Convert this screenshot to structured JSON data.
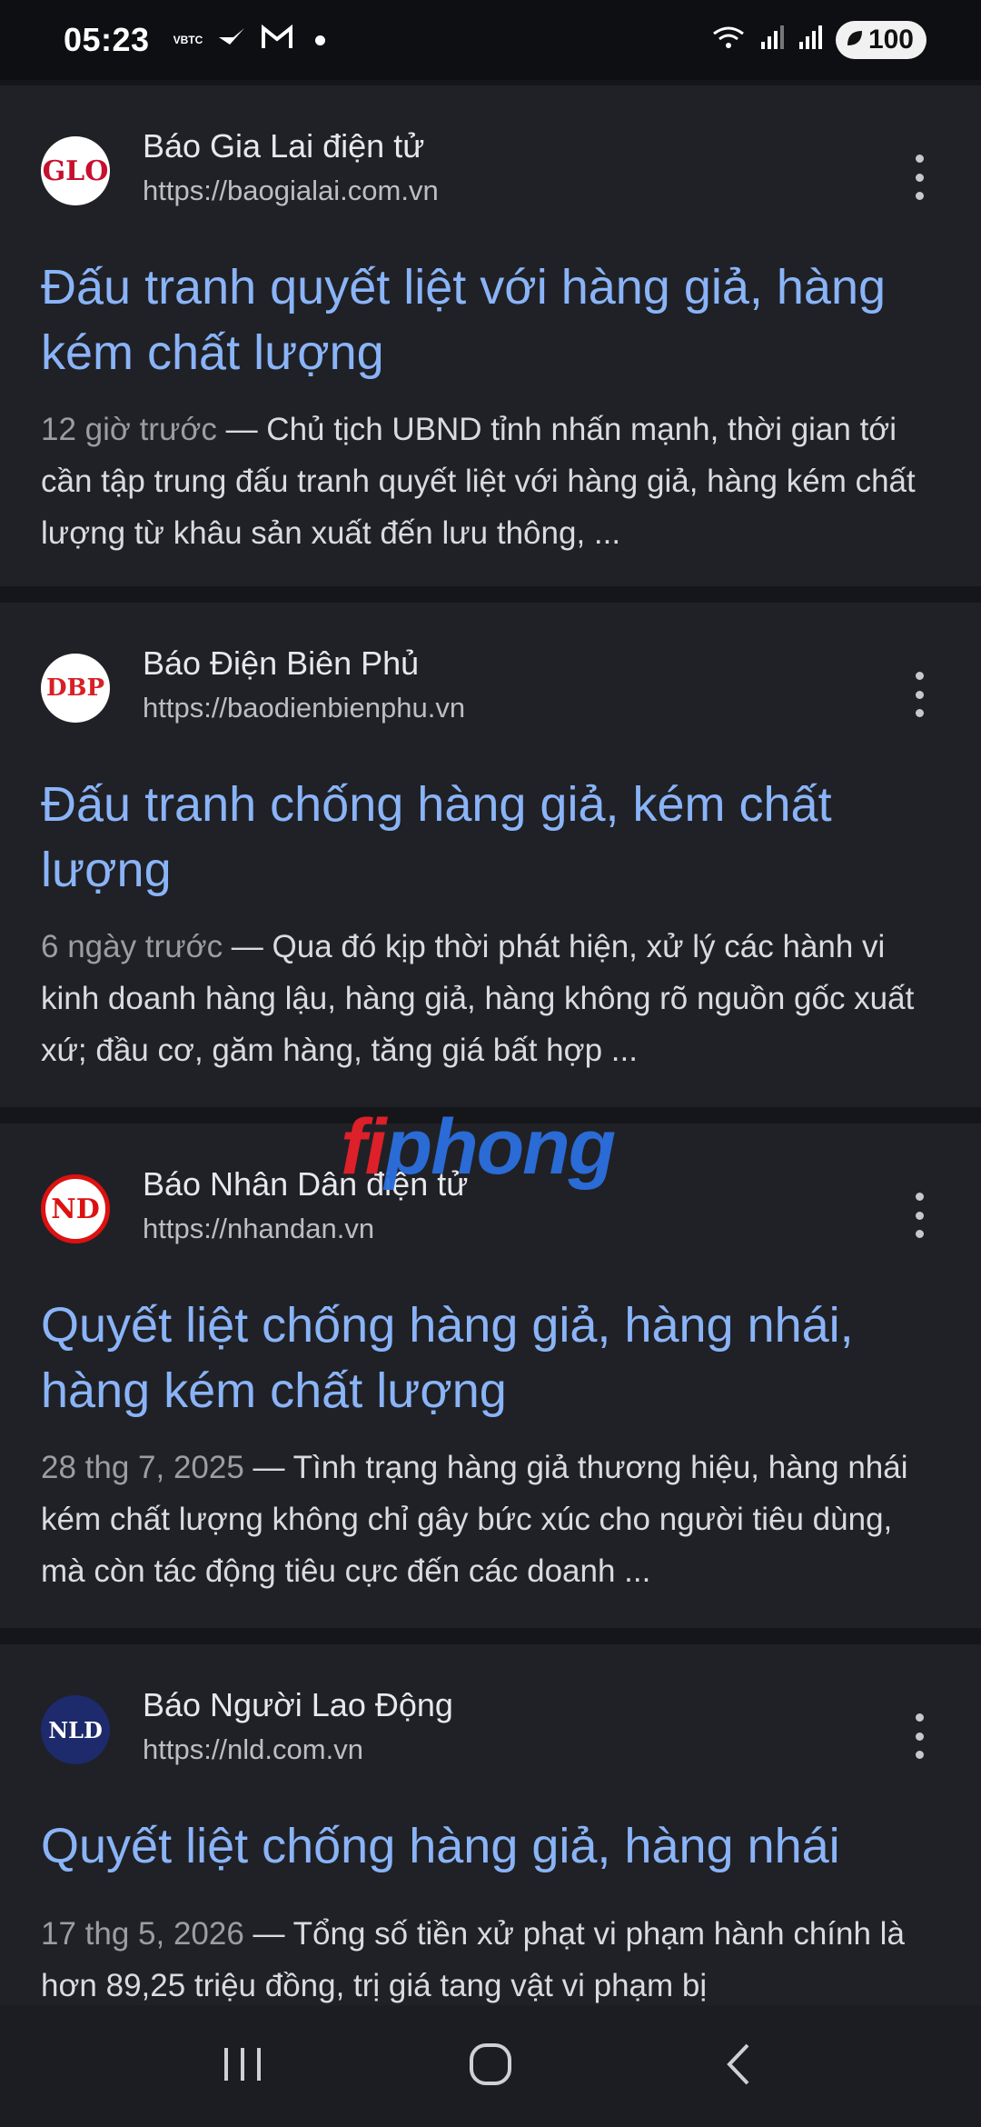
{
  "status_bar": {
    "time": "05:23",
    "carrier_label": "VBTC",
    "battery": "100",
    "icons": [
      "bird-icon",
      "gmail-icon",
      "notification-dot",
      "wifi-icon",
      "signal-icon",
      "signal-icon",
      "battery-icon"
    ]
  },
  "results": [
    {
      "source_name": "Báo Gia Lai điện tử",
      "url": "https://baogialai.com.vn",
      "favicon_text": "GLO",
      "title": "Đấu tranh quyết liệt với hàng giả, hàng kém chất lượng",
      "date": "12 giờ trước",
      "snippet": " — Chủ tịch UBND tỉnh nhấn mạnh, thời gian tới cần tập trung đấu tranh quyết liệt với hàng giả, hàng kém chất lượng từ khâu sản xuất đến lưu thông, ..."
    },
    {
      "source_name": "Báo Điện Biên Phủ",
      "url": "https://baodienbienphu.vn",
      "favicon_text": "DBP",
      "title": "Đấu tranh chống hàng giả, kém chất lượng",
      "date": "6 ngày trước",
      "snippet": " — Qua đó kịp thời phát hiện, xử lý các hành vi kinh doanh hàng lậu, hàng giả, hàng không rõ nguồn gốc xuất xứ; đầu cơ, găm hàng, tăng giá bất hợp ..."
    },
    {
      "source_name": "Báo Nhân Dân điện tử",
      "url": "https://nhandan.vn",
      "favicon_text": "ND",
      "title": "Quyết liệt chống hàng giả, hàng nhái, hàng kém chất lượng",
      "date": "28 thg 7, 2025",
      "snippet": " — Tình trạng hàng giả thương hiệu, hàng nhái kém chất lượng không chỉ gây bức xúc cho người tiêu dùng, mà còn tác động tiêu cực đến các doanh ..."
    },
    {
      "source_name": "Báo Người Lao Động",
      "url": "https://nld.com.vn",
      "favicon_text": "NLD",
      "title": "Quyết liệt chống hàng giả, hàng nhái",
      "date": "17 thg 5, 2026",
      "snippet": " — Tổng số tiền xử phạt vi phạm hành chính là hơn 89,25 triệu đồng, trị giá tang vật vi phạm bị"
    }
  ],
  "watermark": {
    "part_a": "fi",
    "part_b": "phong"
  },
  "colors": {
    "background": "#15161a",
    "card": "#202126",
    "link_title": "#8ab4f8",
    "snippet_text": "#dadbe0",
    "date_text": "#9c9da3"
  }
}
